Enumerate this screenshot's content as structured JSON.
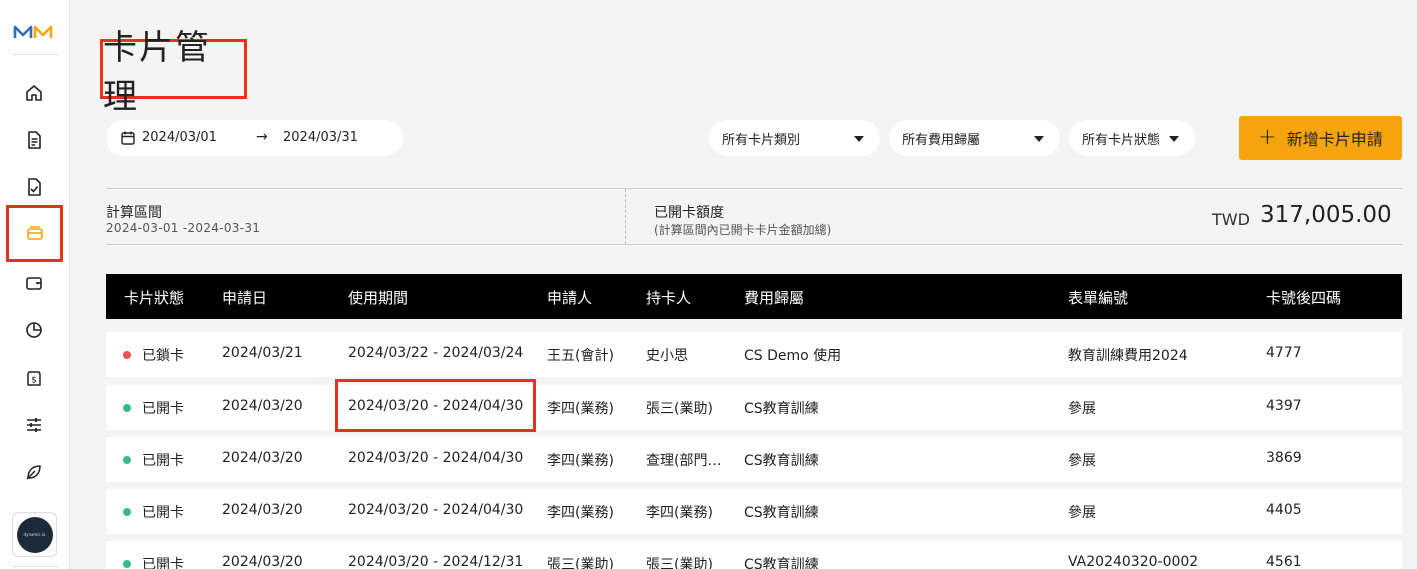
{
  "brand": {
    "logo_text": "MM",
    "logo_colors": [
      "#2d6fb8",
      "#f5a40b"
    ]
  },
  "sidebar": {
    "items": [
      {
        "icon": "home-icon",
        "active": false
      },
      {
        "icon": "document-icon",
        "active": false
      },
      {
        "icon": "document-check-icon",
        "active": false
      },
      {
        "icon": "credit-card-icon",
        "active": true
      },
      {
        "icon": "wallet-icon",
        "active": false
      },
      {
        "icon": "pie-chart-icon",
        "active": false
      },
      {
        "icon": "dollar-circle-icon",
        "active": false
      },
      {
        "icon": "sliders-icon",
        "active": false
      },
      {
        "icon": "leaf-icon",
        "active": false
      }
    ],
    "avatar_text": "dynamic.io"
  },
  "page": {
    "title": "卡片管理"
  },
  "filters": {
    "date_start": "2024/03/01",
    "date_end": "2024/03/31",
    "card_type": "所有卡片類別",
    "cost_owner": "所有費用歸屬",
    "card_status": "所有卡片狀態",
    "add_button": "新增卡片申請"
  },
  "summary": {
    "period_label": "計算區間",
    "period_value": "2024-03-01 -2024-03-31",
    "limit_label": "已開卡額度",
    "limit_note": "(計算區間內已開卡卡片金額加總)",
    "currency": "TWD",
    "amount": "317,005.00"
  },
  "table": {
    "headers": [
      "卡片狀態",
      "申請日",
      "使用期間",
      "申請人",
      "持卡人",
      "費用歸屬",
      "表單編號",
      "卡號後四碼"
    ],
    "rows": [
      {
        "status": "已鎖卡",
        "status_color": "#e8505b",
        "apply_date": "2024/03/21",
        "period": "2024/03/22 - 2024/03/24",
        "applicant": "王五(會計)",
        "holder": "史小思",
        "cost": "CS Demo 使用",
        "form": "教育訓練費用2024",
        "last4": "4777",
        "highlight": false
      },
      {
        "status": "已開卡",
        "status_color": "#3cb98a",
        "apply_date": "2024/03/20",
        "period": "2024/03/20 - 2024/04/30",
        "applicant": "李四(業務)",
        "holder": "張三(業助)",
        "cost": "CS教育訓練",
        "form": "參展",
        "last4": "4397",
        "highlight": true
      },
      {
        "status": "已開卡",
        "status_color": "#3cb98a",
        "apply_date": "2024/03/20",
        "period": "2024/03/20 - 2024/04/30",
        "applicant": "李四(業務)",
        "holder": "查理(部門…",
        "cost": "CS教育訓練",
        "form": "參展",
        "last4": "3869",
        "highlight": false
      },
      {
        "status": "已開卡",
        "status_color": "#3cb98a",
        "apply_date": "2024/03/20",
        "period": "2024/03/20 - 2024/04/30",
        "applicant": "李四(業務)",
        "holder": "李四(業務)",
        "cost": "CS教育訓練",
        "form": "參展",
        "last4": "4405",
        "highlight": false
      },
      {
        "status": "已開卡",
        "status_color": "#3cb98a",
        "apply_date": "2024/03/20",
        "period": "2024/03/20 - 2024/12/31",
        "applicant": "張三(業助)",
        "holder": "張三(業助)",
        "cost": "CS教育訓練",
        "form": "VA20240320-0002",
        "last4": "4561",
        "highlight": false
      }
    ]
  }
}
